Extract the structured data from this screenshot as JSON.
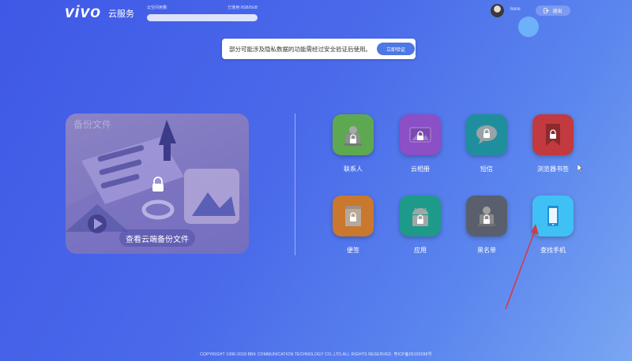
{
  "header": {
    "logo": "vivo",
    "service": "云服务",
    "storage": {
      "label": "云空间用量:",
      "usage": "已使用 0GB/5GB",
      "used_fraction": 0.0
    },
    "username": "lione",
    "logout_label": "退出"
  },
  "notice": {
    "text": "部分可能涉及隐私数据的功能需经过安全验证后使用。",
    "button": "立即验证"
  },
  "backup_card": {
    "title": "备份文件",
    "button": "查看云端备份文件"
  },
  "apps": [
    {
      "id": "contacts",
      "label": "联系人",
      "color": "#5fa852",
      "icon": "contacts-icon"
    },
    {
      "id": "album",
      "label": "云相册",
      "color": "#8b4fc6",
      "icon": "album-icon"
    },
    {
      "id": "sms",
      "label": "短信",
      "color": "#1f8f9e",
      "icon": "sms-icon"
    },
    {
      "id": "bookmarks",
      "label": "浏览器书签",
      "color": "#c23a3f",
      "icon": "bookmark-icon"
    },
    {
      "id": "notes",
      "label": "便签",
      "color": "#c9782e",
      "icon": "notes-icon"
    },
    {
      "id": "apps",
      "label": "应用",
      "color": "#1e9a8a",
      "icon": "android-icon"
    },
    {
      "id": "blacklist",
      "label": "黑名单",
      "color": "#5a5f6e",
      "icon": "blacklist-icon"
    },
    {
      "id": "findphone",
      "label": "查找手机",
      "color": "#3fc1f5",
      "icon": "phone-icon"
    }
  ],
  "footer": "COPYRIGHT 1996-2018 BBK COMMUNICATION TECHNOLOGY CO.,LTD.ALL RIGHTS RESERVED. 粤ICP备05100288号"
}
